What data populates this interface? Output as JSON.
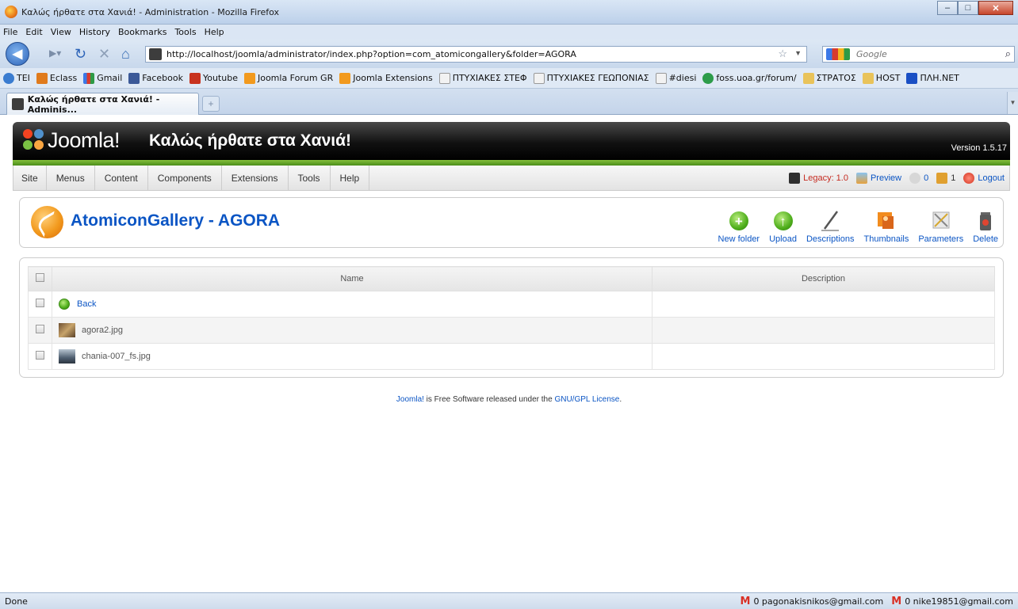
{
  "browser": {
    "window_title": "Καλώς ήρθατε στα Χανιά! - Administration - Mozilla Firefox",
    "menu": [
      "File",
      "Edit",
      "View",
      "History",
      "Bookmarks",
      "Tools",
      "Help"
    ],
    "url": "http://localhost/joomla/administrator/index.php?option=com_atomicongallery&folder=AGORA",
    "search_placeholder": "Google",
    "bookmarks": [
      "TEI",
      "Eclass",
      "Gmail",
      "Facebook",
      "Youtube",
      "Joomla Forum GR",
      "Joomla Extensions",
      "ΠΤΥΧΙΑΚΕΣ ΣΤΕΦ",
      "ΠΤΥΧΙΑΚΕΣ ΓΕΩΠΟΝΙΑΣ",
      "#diesi",
      "foss.uoa.gr/forum/",
      "ΣΤΡΑΤΟΣ",
      "HOST",
      "ΠΛΗ.ΝΕΤ"
    ],
    "tab_title": "Καλώς ήρθατε στα Χανιά! - Adminis...",
    "status_text": "Done",
    "mail_1": "0 pagonakisnikos@gmail.com",
    "mail_2": "0 nike19851@gmail.com"
  },
  "joomla": {
    "brand": "Joomla!",
    "site_name": "Καλώς ήρθατε στα Χανιά!",
    "version": "Version 1.5.17",
    "menu": [
      "Site",
      "Menus",
      "Content",
      "Components",
      "Extensions",
      "Tools",
      "Help"
    ],
    "status": {
      "legacy": "Legacy: 1.0",
      "preview": "Preview",
      "messages": "0",
      "users": "1",
      "logout": "Logout"
    },
    "page_title": "AtomiconGallery - AGORA",
    "toolbar": [
      "New folder",
      "Upload",
      "Descriptions",
      "Thumbnails",
      "Parameters",
      "Delete"
    ],
    "table": {
      "columns": [
        "Name",
        "Description"
      ],
      "rows": [
        {
          "name": "Back",
          "description": ""
        },
        {
          "name": "agora2.jpg",
          "description": ""
        },
        {
          "name": "chania-007_fs.jpg",
          "description": ""
        }
      ]
    },
    "footer": {
      "brand": "Joomla!",
      "text": " is Free Software released under the ",
      "license": "GNU/GPL License",
      "end": "."
    }
  },
  "colors": {
    "link_blue": "#0b55c4",
    "joomla_green": "#6aab2c",
    "header_black": "#000000"
  }
}
